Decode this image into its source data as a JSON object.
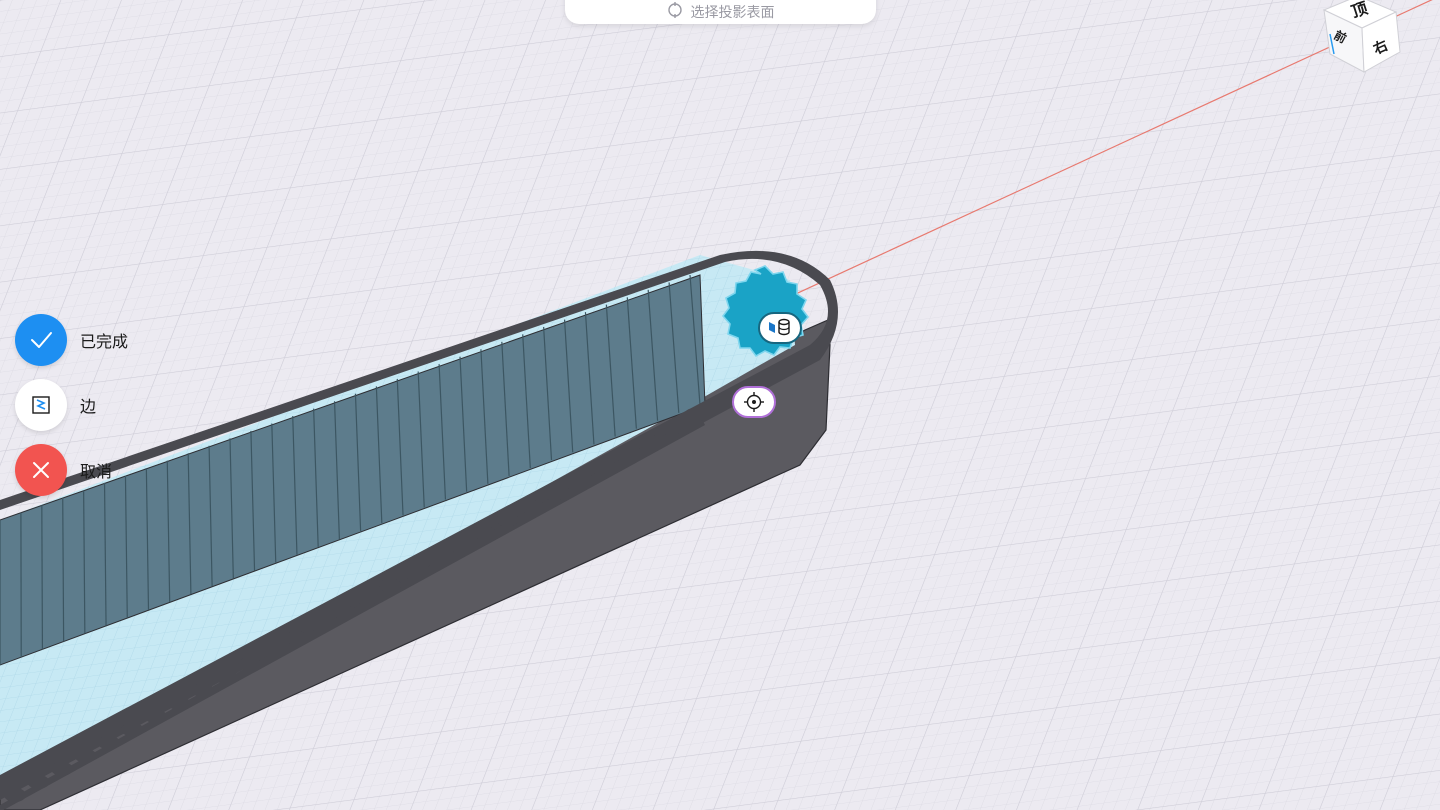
{
  "prompt": {
    "text": "选择投影表面",
    "icon": "target-icon"
  },
  "toolbar": {
    "done_label": "已完成",
    "edge_label": "边",
    "cancel_label": "取消"
  },
  "colors": {
    "background": "#eceaf1",
    "grid_minor": "#dcdae3",
    "grid_major": "#cfcdd8",
    "axis_line": "#e8796f",
    "belt_dark": "#5b5a60",
    "belt_top": "#4a4a50",
    "teeth": "#5d7c8c",
    "selected_face": "#1aa3c6",
    "inner_floor": "#c7e9f4",
    "done": "#1d8ff2",
    "cancel": "#f25450"
  },
  "view_cube": {
    "faces": [
      "顶",
      "右",
      "前"
    ]
  }
}
